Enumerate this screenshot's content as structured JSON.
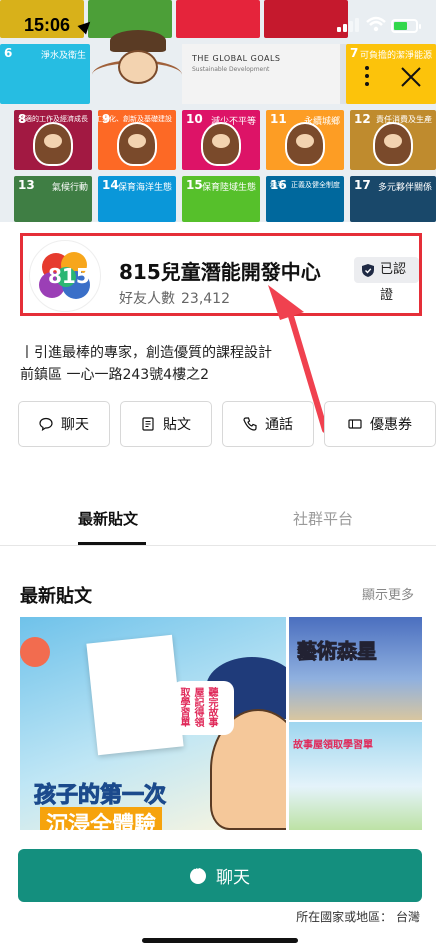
{
  "status_bar": {
    "time": "15:06"
  },
  "cover": {
    "goals_title": "THE GLOBAL GOALS",
    "goals_sub": "Sustainable Development",
    "tiles": [
      {
        "num": "6",
        "label": "淨水及衛生",
        "color": "#26bde2"
      },
      {
        "num": "7",
        "label": "可負擔的潔淨能源",
        "color": "#fcc30b"
      },
      {
        "num": "8",
        "label": "合適的工作及經濟成長",
        "color": "#a21942"
      },
      {
        "num": "9",
        "label": "工業化、創新及基礎建設",
        "color": "#fd6925"
      },
      {
        "num": "10",
        "label": "減少不平等",
        "color": "#dd1367"
      },
      {
        "num": "11",
        "label": "永續城鄉",
        "color": "#fd9d24"
      },
      {
        "num": "12",
        "label": "責任消費及生產",
        "color": "#bf8b2e"
      },
      {
        "num": "13",
        "label": "氣候行動",
        "color": "#3f7e44"
      },
      {
        "num": "14",
        "label": "保育海洋生態",
        "color": "#0a97d9"
      },
      {
        "num": "15",
        "label": "保育陸域生態",
        "color": "#56c02b"
      },
      {
        "num": "16",
        "label": "和平、正義及健全制度",
        "color": "#00689d"
      },
      {
        "num": "17",
        "label": "多元夥伴關係",
        "color": "#19486a"
      }
    ]
  },
  "profile": {
    "name": "815兒童潛能開發中心",
    "verified_label": "已認證",
    "friends_label": "好友人數",
    "friends_count": "23,412"
  },
  "description": "丨引進最棒的專家，創造優質的課程設計",
  "address": "前鎮區 一心一路243號4樓之2",
  "actions": {
    "chat": "聊天",
    "posts": "貼文",
    "call": "通話",
    "coupon": "優惠券"
  },
  "tabs": {
    "latest": "最新貼文",
    "social": "社群平台"
  },
  "posts_section": {
    "title": "最新貼文",
    "show_more": "顯示更多"
  },
  "post_images": {
    "main_line1": "孩子的第一次",
    "main_line2": "沉浸全體驗",
    "bubble": "聽完故事屋記得領取學習單",
    "top_sign": "藝術森星",
    "bottom_text": "故事屋領取學習單"
  },
  "chat_button": "聊天",
  "region": "所在國家或地區： 台灣",
  "colors": {
    "accent_green": "#148f7e",
    "highlight_red": "#e52e38"
  }
}
